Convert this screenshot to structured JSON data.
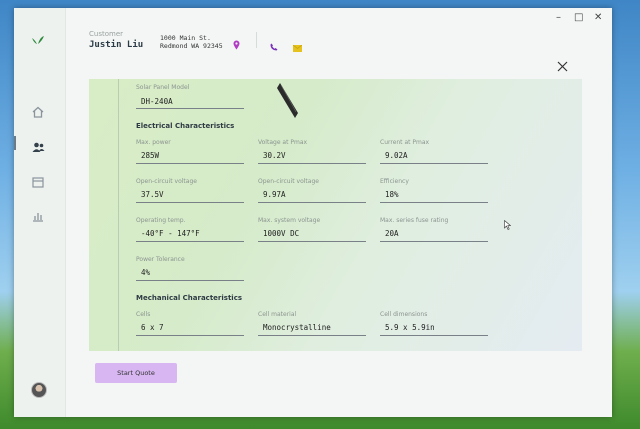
{
  "window": {
    "controls": {
      "minimize": "–",
      "maximize": "□",
      "close": "✕"
    }
  },
  "sidebar": {
    "items": [
      {
        "icon": "home-icon"
      },
      {
        "icon": "users-icon",
        "active": true
      },
      {
        "icon": "calendar-icon"
      },
      {
        "icon": "chart-icon"
      }
    ]
  },
  "header": {
    "customer_label": "Customer",
    "customer_name": "Justin Liu",
    "address_line1": "1000 Main St.",
    "address_line2": "Redmond WA 92345"
  },
  "specs": {
    "model_label": "Solar Panel Model",
    "model_value": "DH-240A",
    "electrical_title": "Electrical Characteristics",
    "max_power_label": "Max. power",
    "max_power_value": "285W",
    "voltage_pmax_label": "Voltage at Pmax",
    "voltage_pmax_value": "30.2V",
    "current_pmax_label": "Current at Pmax",
    "current_pmax_value": "9.02A",
    "ocv_label": "Open-circuit voltage",
    "ocv_value": "37.5V",
    "ocv2_label": "Open-circuit voltage",
    "ocv2_value": "9.97A",
    "efficiency_label": "Efficiency",
    "efficiency_value": "18%",
    "op_temp_label": "Operating temp.",
    "op_temp_value": "-40°F - 147°F",
    "max_sys_voltage_label": "Max. system voltage",
    "max_sys_voltage_value": "1000V DC",
    "max_fuse_label": "Max. series fuse rating",
    "max_fuse_value": "20A",
    "power_tol_label": "Power Tolerance",
    "power_tol_value": "4%",
    "mechanical_title": "Mechanical Characteristics",
    "cells_label": "Cells",
    "cells_value": "6 x 7",
    "cell_material_label": "Cell material",
    "cell_material_value": "Monocrystalline",
    "cell_dims_label": "Cell dimensions",
    "cell_dims_value": "5.9 x 5.9in"
  },
  "actions": {
    "start_quote": "Start Quote"
  },
  "colors": {
    "accent": "#d7b6f1",
    "logo_green": "#2e8b3d",
    "pin": "#b13cc4",
    "phone": "#7a2fb8",
    "mail": "#e6c21f"
  }
}
